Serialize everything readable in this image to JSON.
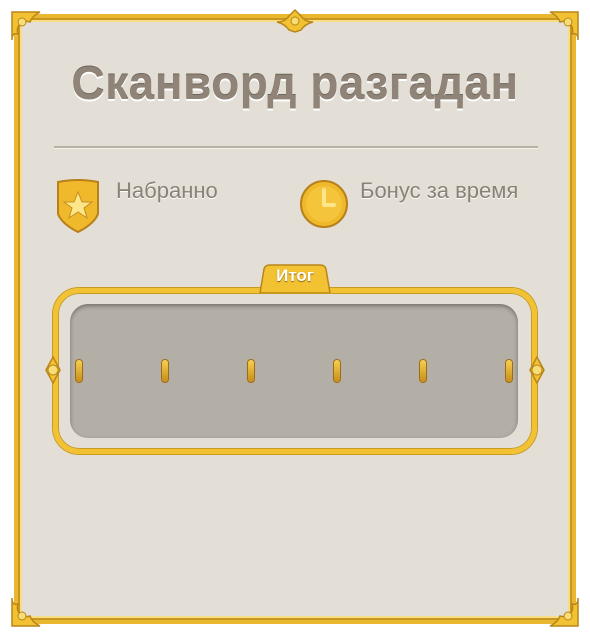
{
  "dialog": {
    "title": "Сканворд разгадан"
  },
  "stats": [
    {
      "label": "Набранно",
      "icon": "star-shield-icon"
    },
    {
      "label": "Бонус за время",
      "icon": "clock-icon"
    }
  ],
  "result": {
    "tab_label": "Итог",
    "slot_count": 6
  },
  "colors": {
    "panel_background": "#e3dfd6",
    "gold": "#f2c233",
    "title_text": "#8f8477",
    "label_text": "#8a8177",
    "result_inner": "#b3aea6"
  }
}
